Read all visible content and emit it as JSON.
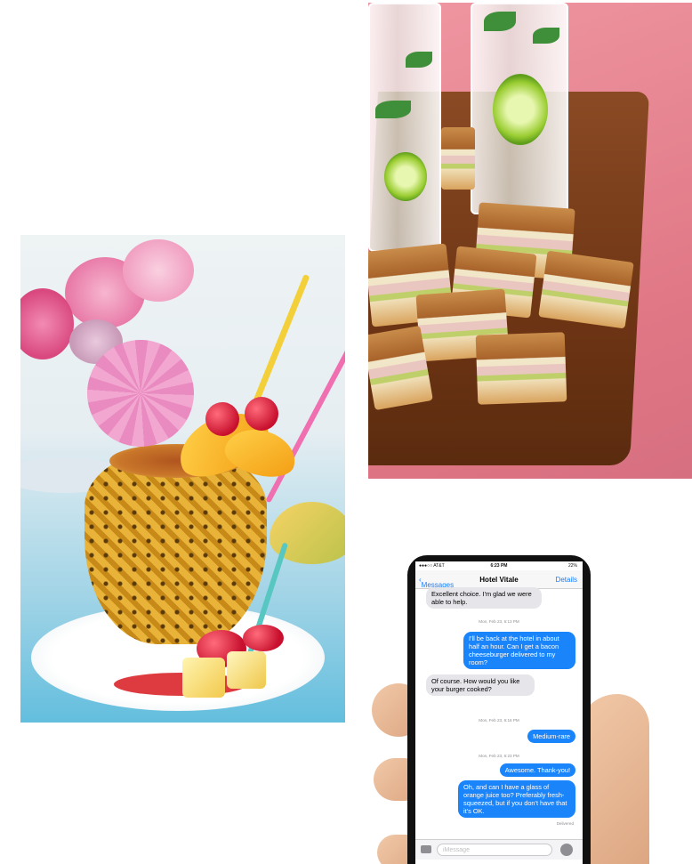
{
  "photos": {
    "pineapple": {
      "icon": "pineapple-drink-photo"
    },
    "sandwiches": {
      "icon": "grilled-sandwiches-photo"
    },
    "phone": {
      "icon": "phone-messages-photo"
    }
  },
  "phone": {
    "status": {
      "carrier": "●●●○○ AT&T",
      "time": "6:23 PM",
      "battery": "22%"
    },
    "nav": {
      "back": "Messages",
      "title": "Hotel Vitale",
      "details": "Details"
    },
    "messages": [
      {
        "dir": "in",
        "text": "Excellent choice. I'm glad we were able to help."
      },
      {
        "dir": "stamp",
        "text": "Mon, Feb 23, 6:13 PM"
      },
      {
        "dir": "out",
        "text": "I'll be back at the hotel in about half an hour. Can I get a bacon cheeseburger delivered to my room?"
      },
      {
        "dir": "in",
        "text": "Of course. How would you like your burger cooked?"
      },
      {
        "dir": "stamp",
        "text": "Mon, Feb 23, 6:16 PM"
      },
      {
        "dir": "out",
        "text": "Medium-rare"
      },
      {
        "dir": "stamp",
        "text": "Mon, Feb 23, 6:23 PM"
      },
      {
        "dir": "out",
        "text": "Awesome. Thank-you!"
      },
      {
        "dir": "out",
        "text": "Oh, and can I have a glass of orange juice too? Preferably fresh-squeezed, but if you don't have that it's OK."
      }
    ],
    "delivered": "Delivered",
    "input_placeholder": "iMessage"
  },
  "colors": {
    "imessage_blue": "#1a84fb",
    "incoming_gray": "#e5e5ea"
  }
}
